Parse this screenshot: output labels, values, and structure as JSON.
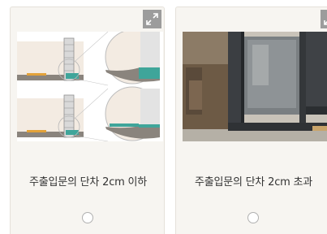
{
  "options": [
    {
      "label": "주출입문의 단차 2cm 이하",
      "icon": "expand-icon",
      "selected": false
    },
    {
      "label": "주출입문의 단차 2cm 초과",
      "icon": "expand-icon",
      "selected": false
    }
  ],
  "colors": {
    "card_bg": "#f7f5f1",
    "card_border": "#e5e1da",
    "expand_button": "#9c9c9c",
    "accent_teal": "#3fa59a",
    "accent_orange": "#e3a23a"
  }
}
